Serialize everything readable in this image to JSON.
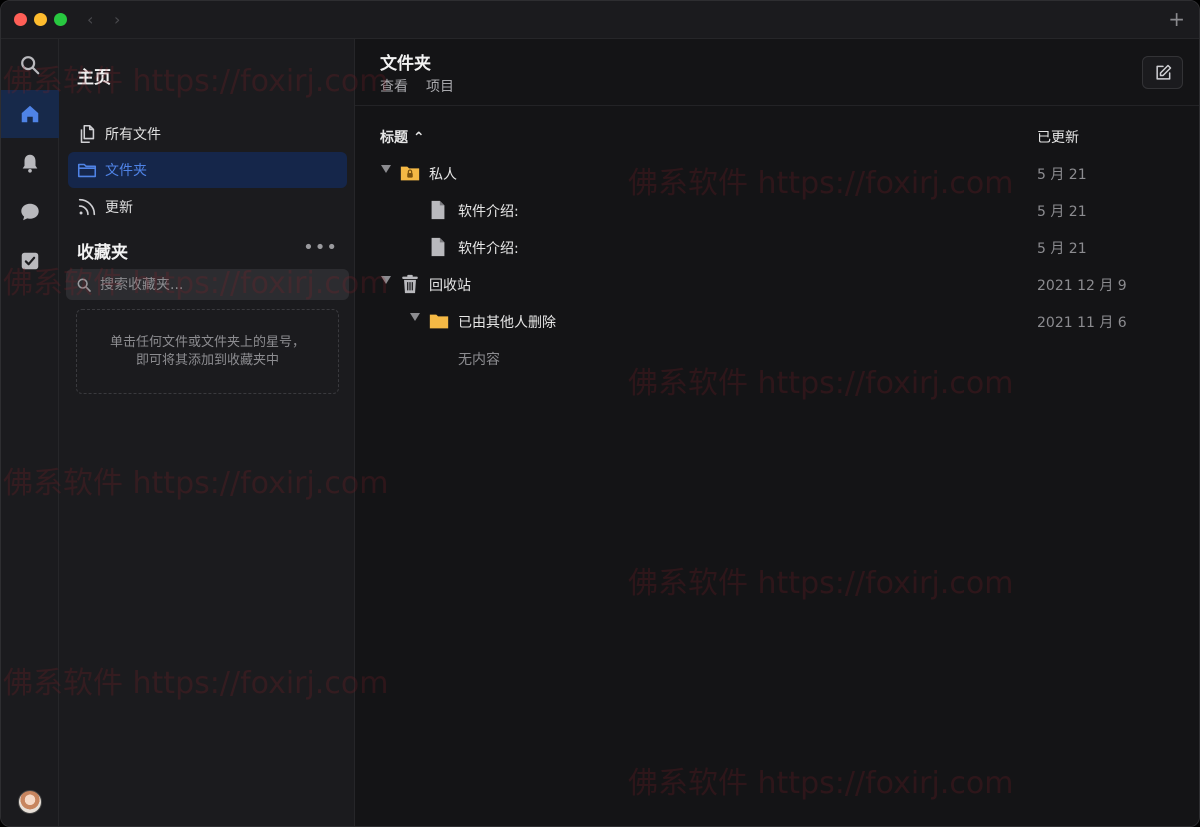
{
  "titlebar": {
    "back_glyph": "‹",
    "forward_glyph": "›",
    "new_tab_glyph": "+"
  },
  "rail": {
    "items": [
      {
        "icon": "search-icon"
      },
      {
        "icon": "home-icon",
        "active": true
      },
      {
        "icon": "bell-icon"
      },
      {
        "icon": "chat-icon"
      },
      {
        "icon": "checkbox-icon"
      }
    ]
  },
  "sidebar": {
    "title": "主页",
    "nav": [
      {
        "label": "所有文件",
        "icon": "files-icon"
      },
      {
        "label": "文件夹",
        "icon": "folder-icon",
        "active": true
      },
      {
        "label": "更新",
        "icon": "rss-icon"
      }
    ],
    "favorites": {
      "title": "收藏夹",
      "more": "•••",
      "search_placeholder": "搜索收藏夹...",
      "empty_text": "单击任何文件或文件夹上的星号，即可将其添加到收藏夹中"
    }
  },
  "main": {
    "title": "文件夹",
    "tabs": [
      {
        "label": "查看"
      },
      {
        "label": "项目"
      }
    ],
    "columns": {
      "title": "标题 ⌃",
      "updated": "已更新"
    },
    "rows": [
      {
        "name": "私人",
        "date": "5 月 21",
        "icon": "locked-folder-icon",
        "level": 0,
        "expanded": true
      },
      {
        "name": "软件介绍:",
        "date": "5 月 21",
        "icon": "document-icon",
        "level": 1
      },
      {
        "name": "软件介绍:",
        "date": "5 月 21",
        "icon": "document-icon",
        "level": 1
      },
      {
        "name": "回收站",
        "date": "2021 12 月 9",
        "icon": "trash-icon",
        "level": 0,
        "expanded": true
      },
      {
        "name": "已由其他人删除",
        "date": "2021 11 月 6",
        "icon": "folder-icon",
        "level": 1,
        "expanded": true
      }
    ],
    "empty_note": "无内容"
  },
  "watermark": "佛系软件 https://foxirj.com",
  "colors": {
    "accent": "#4f83e6",
    "active_bg": "#15264a",
    "folder": "#f5b945",
    "background": "#141416",
    "sidebar": "#1b1b1e"
  }
}
